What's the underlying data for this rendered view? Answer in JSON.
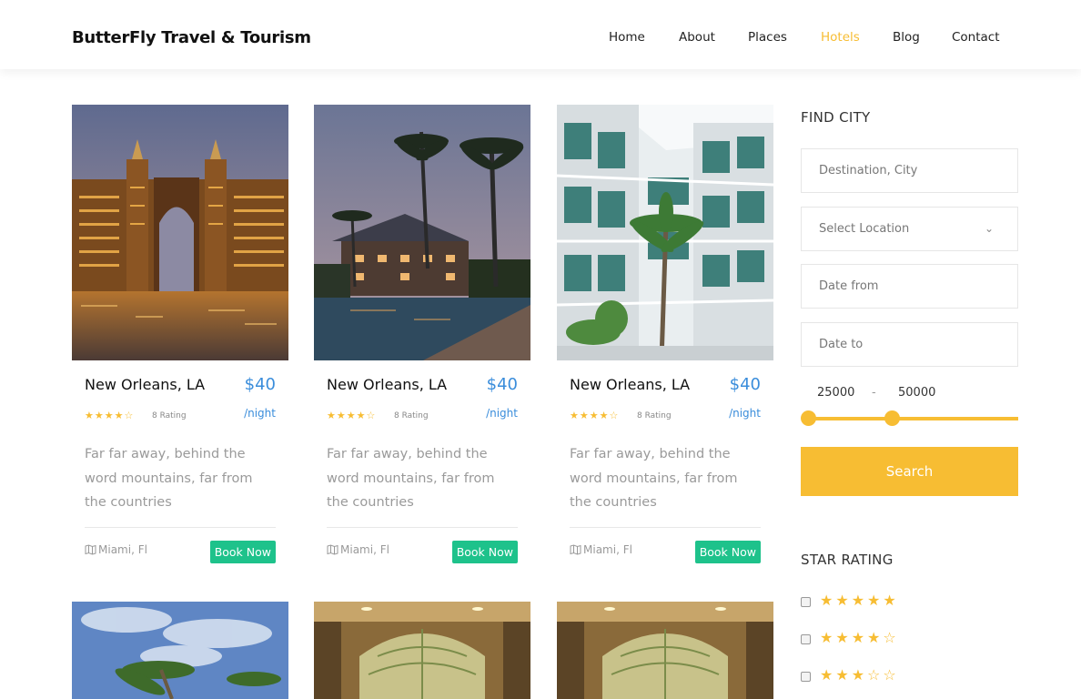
{
  "header": {
    "brand": "ButterFly Travel & Tourism",
    "nav": [
      "Home",
      "About",
      "Places",
      "Hotels",
      "Blog",
      "Contact"
    ],
    "active": "Hotels"
  },
  "cards": [
    {
      "name": "New Orleans, LA",
      "price": "$40",
      "per": "/night",
      "stars": "★★★★☆",
      "rating": "8 Rating",
      "desc": "Far far away, behind the word mountains, far from the countries",
      "location": "Miami, Fl",
      "book": "Book Now"
    },
    {
      "name": "New Orleans, LA",
      "price": "$40",
      "per": "/night",
      "stars": "★★★★☆",
      "rating": "8 Rating",
      "desc": "Far far away, behind the word mountains, far from the countries",
      "location": "Miami, Fl",
      "book": "Book Now"
    },
    {
      "name": "New Orleans, LA",
      "price": "$40",
      "per": "/night",
      "stars": "★★★★☆",
      "rating": "8 Rating",
      "desc": "Far far away, behind the word mountains, far from the countries",
      "location": "Miami, Fl",
      "book": "Book Now"
    }
  ],
  "sidebar": {
    "find_title": "FIND CITY",
    "destination_placeholder": "Destination, City",
    "location_select": "Select Location",
    "date_from_placeholder": "Date from",
    "date_to_placeholder": "Date to",
    "range_min": "25000",
    "range_sep": "-",
    "range_max": "50000",
    "search_label": "Search",
    "star_title": "STAR RATING",
    "star_rows": [
      "★★★★★",
      "★★★★☆",
      "★★★☆☆"
    ]
  },
  "colors": {
    "accent": "#f7bd33",
    "price": "#3a8ddb",
    "book": "#1ec28b"
  }
}
